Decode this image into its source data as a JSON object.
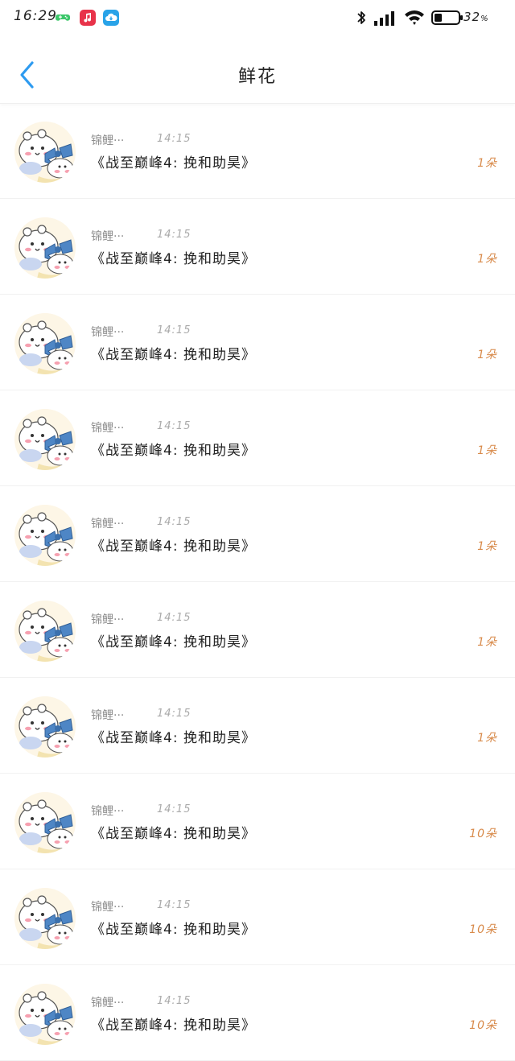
{
  "status_bar": {
    "time": "16:29",
    "apps": [
      "game-controller-icon",
      "music-icon",
      "cloud-icon"
    ],
    "battery_percent": "32",
    "battery_unit": "%"
  },
  "header": {
    "title": "鲜花"
  },
  "gifts": [
    {
      "user": "锦鲤···",
      "time": "14:15",
      "title": "《战至巅峰4: 挽和助昊》",
      "count": "1朵"
    },
    {
      "user": "锦鲤···",
      "time": "14:15",
      "title": "《战至巅峰4: 挽和助昊》",
      "count": "1朵"
    },
    {
      "user": "锦鲤···",
      "time": "14:15",
      "title": "《战至巅峰4: 挽和助昊》",
      "count": "1朵"
    },
    {
      "user": "锦鲤···",
      "time": "14:15",
      "title": "《战至巅峰4: 挽和助昊》",
      "count": "1朵"
    },
    {
      "user": "锦鲤···",
      "time": "14:15",
      "title": "《战至巅峰4: 挽和助昊》",
      "count": "1朵"
    },
    {
      "user": "锦鲤···",
      "time": "14:15",
      "title": "《战至巅峰4: 挽和助昊》",
      "count": "1朵"
    },
    {
      "user": "锦鲤···",
      "time": "14:15",
      "title": "《战至巅峰4: 挽和助昊》",
      "count": "1朵"
    },
    {
      "user": "锦鲤···",
      "time": "14:15",
      "title": "《战至巅峰4: 挽和助昊》",
      "count": "10朵"
    },
    {
      "user": "锦鲤···",
      "time": "14:15",
      "title": "《战至巅峰4: 挽和助昊》",
      "count": "10朵"
    },
    {
      "user": "锦鲤···",
      "time": "14:15",
      "title": "《战至巅峰4: 挽和助昊》",
      "count": "10朵"
    }
  ],
  "colors": {
    "accent": "#2e9bf0",
    "count": "#d88a4a"
  }
}
